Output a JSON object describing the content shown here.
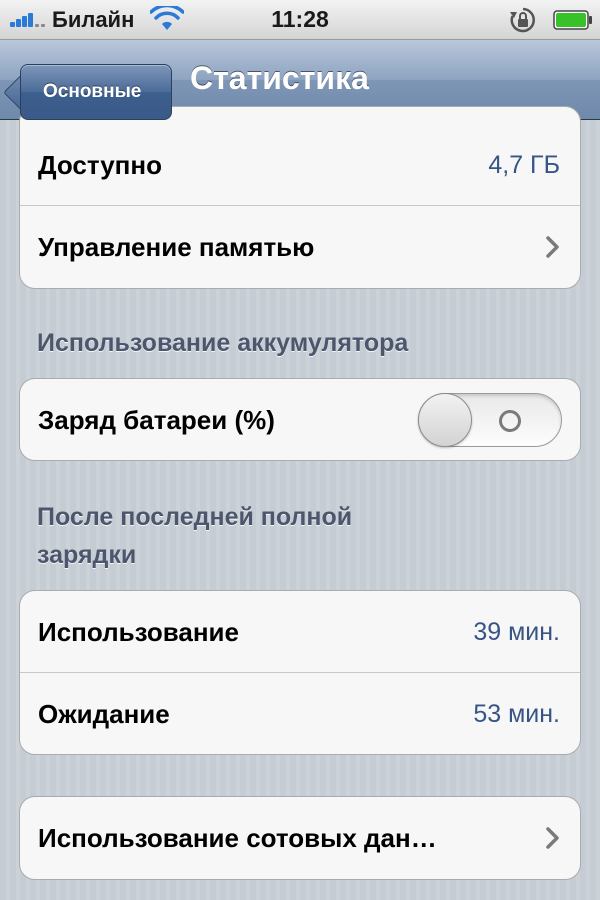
{
  "status_bar": {
    "carrier": "Билайн",
    "time": "11:28",
    "battery_level": 1.0,
    "signal_bars": 4
  },
  "nav": {
    "back_label": "Основные",
    "title": "Статистика"
  },
  "storage_group": {
    "rows": [
      {
        "label": "Доступно",
        "value": "4,7 ГБ"
      },
      {
        "label": "Управление памятью"
      }
    ]
  },
  "battery_section": {
    "header": "Использование аккумулятора",
    "row_label": "Заряд батареи (%)",
    "toggle_on": false
  },
  "since_charge_section": {
    "header_line1": "После последней полной",
    "header_line2": "зарядки",
    "rows": [
      {
        "label": "Использование",
        "value": "39 мин."
      },
      {
        "label": "Ожидание",
        "value": "53 мин."
      }
    ]
  },
  "cellular_group": {
    "label": "Использование сотовых дан…"
  },
  "colors": {
    "value_text": "#385487",
    "header_text": "#4c566c",
    "signal": "#2a7ad6",
    "battery_fill": "#37c22a"
  }
}
